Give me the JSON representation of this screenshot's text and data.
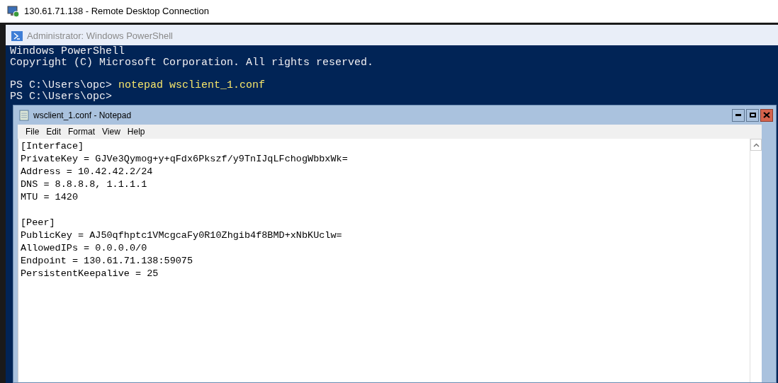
{
  "window": {
    "title": "130.61.71.138 - Remote Desktop Connection"
  },
  "powershell": {
    "title": "Administrator: Windows PowerShell",
    "blocks": [
      [
        {
          "prompt": "Windows PowerShell"
        },
        {
          "prompt": "Copyright (C) Microsoft Corporation. All rights reserved."
        }
      ],
      [
        {
          "prompt": "PS C:\\Users\\opc>",
          "command": "notepad wsclient_1.conf"
        },
        {
          "prompt": "PS C:\\Users\\opc>"
        }
      ]
    ]
  },
  "notepad": {
    "title": "wsclient_1.conf - Notepad",
    "menu": [
      "File",
      "Edit",
      "Format",
      "View",
      "Help"
    ],
    "sections": [
      [
        "[Interface]",
        "PrivateKey = GJVe3Qymog+y+qFdx6Pkszf/y9TnIJqLFchogWbbxWk=",
        "Address = 10.42.42.2/24",
        "DNS = 8.8.8.8, 1.1.1.1",
        "MTU = 1420"
      ],
      [
        "[Peer]",
        "PublicKey = AJ50qfhptc1VMcgcaFy0R10Zhgib4f8BMD+xNbKUclw=",
        "AllowedIPs = 0.0.0.0/0",
        "Endpoint = 130.61.71.138:59075",
        "PersistentKeepalive = 25"
      ]
    ]
  }
}
